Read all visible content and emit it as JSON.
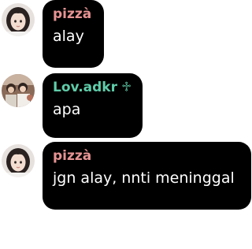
{
  "messages": [
    {
      "sender": "pizzà",
      "text": "alay",
      "avatar_icon": "user-avatar-girl",
      "name_color": "#e79393"
    },
    {
      "sender": "Lov.adkr",
      "badge": "♱",
      "text": "apa",
      "avatar_icon": "user-avatar-group-photo",
      "name_color": "#5fcca9"
    },
    {
      "sender": "pizzà",
      "text": "jgn alay, nnti meninggal",
      "avatar_icon": "user-avatar-girl",
      "name_color": "#e79393"
    }
  ],
  "colors": {
    "bubble_bg": "#000000",
    "message_text": "#ffffff",
    "page_bg": "#ffffff"
  }
}
